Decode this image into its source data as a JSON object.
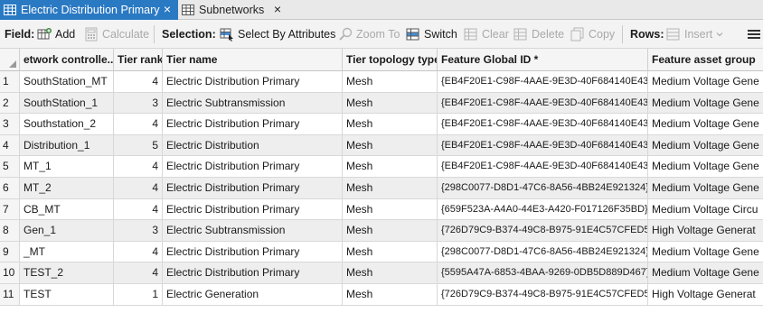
{
  "tabs": [
    {
      "label": "Electric Distribution Primary",
      "active": true,
      "close": "×"
    },
    {
      "label": "Subnetworks",
      "active": false,
      "close": "×"
    }
  ],
  "toolbar": {
    "field_label": "Field:",
    "add": "Add",
    "calculate": "Calculate",
    "selection_label": "Selection:",
    "select_by_attributes": "Select By Attributes",
    "zoom_to": "Zoom To",
    "switch": "Switch",
    "clear": "Clear",
    "delete": "Delete",
    "copy": "Copy",
    "rows_label": "Rows:",
    "insert": "Insert"
  },
  "table": {
    "columns": [
      "etwork controlle...",
      "Tier rank",
      "Tier name",
      "Tier topology type",
      "Feature Global ID *",
      "Feature asset group"
    ],
    "rows": [
      {
        "n": "1",
        "c": [
          "SouthStation_MT",
          "4",
          "Electric Distribution Primary",
          "Mesh",
          "{EB4F20E1-C98F-4AAE-9E3D-40F684140E43}",
          "Medium Voltage Gene"
        ]
      },
      {
        "n": "2",
        "c": [
          "SouthStation_1",
          "3",
          "Electric Subtransmission",
          "Mesh",
          "{EB4F20E1-C98F-4AAE-9E3D-40F684140E43}",
          "Medium Voltage Gene"
        ]
      },
      {
        "n": "3",
        "c": [
          "Southstation_2",
          "4",
          "Electric Distribution Primary",
          "Mesh",
          "{EB4F20E1-C98F-4AAE-9E3D-40F684140E43}",
          "Medium Voltage Gene"
        ]
      },
      {
        "n": "4",
        "c": [
          "Distribution_1",
          "5",
          "Electric Distribution",
          "Mesh",
          "{EB4F20E1-C98F-4AAE-9E3D-40F684140E43}",
          "Medium Voltage Gene"
        ]
      },
      {
        "n": "5",
        "c": [
          "MT_1",
          "4",
          "Electric Distribution Primary",
          "Mesh",
          "{EB4F20E1-C98F-4AAE-9E3D-40F684140E43}",
          "Medium Voltage Gene"
        ]
      },
      {
        "n": "6",
        "c": [
          "MT_2",
          "4",
          "Electric Distribution Primary",
          "Mesh",
          "{298C0077-D8D1-47C6-8A56-4BB24E921324}",
          "Medium Voltage Gene"
        ]
      },
      {
        "n": "7",
        "c": [
          "CB_MT",
          "4",
          "Electric Distribution Primary",
          "Mesh",
          "{659F523A-A4A0-44E3-A420-F017126F35BD}",
          "Medium Voltage Circu"
        ]
      },
      {
        "n": "8",
        "c": [
          "Gen_1",
          "3",
          "Electric Subtransmission",
          "Mesh",
          "{726D79C9-B374-49C8-B975-91E4C57CFED5}",
          "High Voltage Generat"
        ]
      },
      {
        "n": "9",
        "c": [
          "_MT",
          "4",
          "Electric Distribution Primary",
          "Mesh",
          "{298C0077-D8D1-47C6-8A56-4BB24E921324}",
          "Medium Voltage Gene"
        ]
      },
      {
        "n": "10",
        "c": [
          "TEST_2",
          "4",
          "Electric Distribution Primary",
          "Mesh",
          "{5595A47A-6853-4BAA-9269-0DB5D889D467}",
          "Medium Voltage Gene"
        ]
      },
      {
        "n": "11",
        "c": [
          "TEST",
          "1",
          "Electric Generation",
          "Mesh",
          "{726D79C9-B374-49C8-B975-91E4C57CFED5}",
          "High Voltage Generat"
        ]
      }
    ]
  }
}
